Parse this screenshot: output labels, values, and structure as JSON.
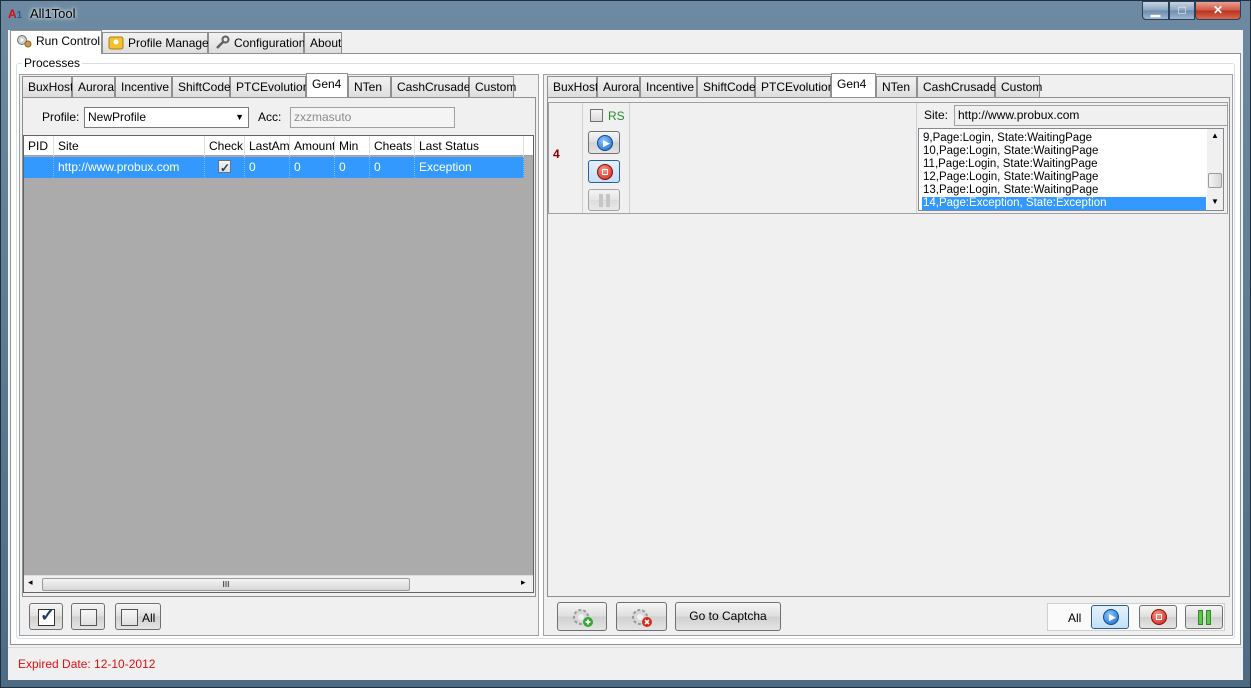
{
  "window": {
    "title": "All1Tool"
  },
  "main_tabs": [
    {
      "label": "Run Control"
    },
    {
      "label": "Profile Manager"
    },
    {
      "label": "Configuration"
    },
    {
      "label": "About"
    }
  ],
  "processes_label": "Processes",
  "site_tabs": [
    "BuxHost",
    "Aurora",
    "Incentive",
    "ShiftCode",
    "PTCEvolution",
    "Gen4",
    "NTen",
    "CashCrusader",
    "Custom"
  ],
  "left": {
    "profile_label": "Profile:",
    "profile_value": "NewProfile",
    "acc_label": "Acc:",
    "acc_value": "zxzmasuto",
    "columns": [
      "PID",
      "Site",
      "Check",
      "LastAmt",
      "Amount",
      "Min",
      "Cheats",
      "Last Status"
    ],
    "rows": [
      {
        "pid": "",
        "site": "http://www.probux.com",
        "check": true,
        "lastamt": "0",
        "amount": "0",
        "min": "0",
        "cheats": "0",
        "status": "Exception"
      }
    ],
    "scroll_grip": "III",
    "all_label": "All"
  },
  "right": {
    "process_number": "4",
    "rs_label": "RS",
    "site_label": "Site:",
    "site_value": "http://www.probux.com",
    "log": [
      "9,Page:Login, State:WaitingPage",
      "10,Page:Login, State:WaitingPage",
      "11,Page:Login, State:WaitingPage",
      "12,Page:Login, State:WaitingPage",
      "13,Page:Login, State:WaitingPage",
      "14,Page:Exception, State:Exception"
    ],
    "captcha_button": "Go to Captcha",
    "all_label": "All"
  },
  "status": {
    "expired": "Expired Date: 12-10-2012"
  },
  "colors": {
    "selection": "#3399ff",
    "expired_text": "#e01010",
    "rs_text": "#2a8a2a",
    "number_text": "#8b0000"
  }
}
